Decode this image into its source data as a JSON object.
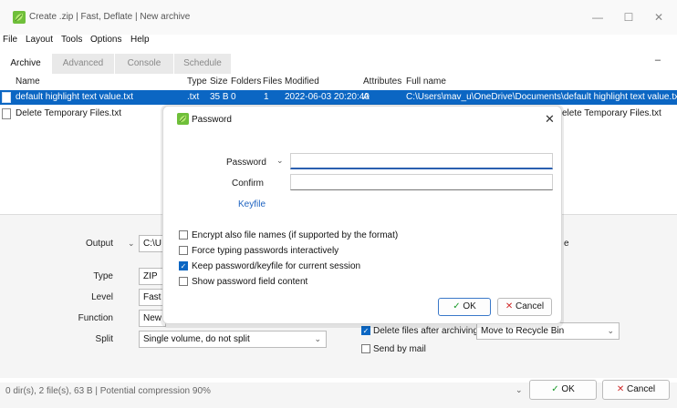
{
  "window": {
    "title": "Create .zip | Fast, Deflate | New archive",
    "minimize": "—",
    "maximize": "☐",
    "close": "✕"
  },
  "menu": [
    "File",
    "Layout",
    "Tools",
    "Options",
    "Help"
  ],
  "tabs": [
    "Archive",
    "Advanced",
    "Console",
    "Schedule"
  ],
  "tab_dash": "–",
  "columns": [
    "Name",
    "Type",
    "Size",
    "Folders",
    "Files",
    "Modified",
    "Attributes",
    "Full name"
  ],
  "rows": [
    {
      "name": "default highlight text value.txt",
      "type": ".txt",
      "size": "35 B",
      "folders": "0",
      "files": "1",
      "modified": "2022-06-03 20:20:40",
      "attributes": "A",
      "fullname": "C:\\Users\\mav_u\\OneDrive\\Documents\\default highlight text value.txt"
    },
    {
      "name": "Delete Temporary Files.txt",
      "fullname_tail": "elete Temporary Files.txt"
    }
  ],
  "lower": {
    "output_label": "Output",
    "output_value": "C:\\U",
    "type_label": "Type",
    "type_value": "ZIP",
    "level_label": "Level",
    "level_value": "Fast",
    "function_label": "Function",
    "function_value": "New",
    "split_label": "Split",
    "split_value": "Single volume, do not split",
    "right_e": "e",
    "delete_after": "Delete files after archiving",
    "delete_after_checked": true,
    "delete_mode": "Move to Recycle Bin",
    "send_mail": "Send by mail",
    "send_mail_checked": false
  },
  "status": {
    "text": "0 dir(s), 2 file(s), 63 B | Potential compression 90%",
    "ok": "OK",
    "cancel": "Cancel"
  },
  "dialog": {
    "title": "Password",
    "close": "✕",
    "password_label": "Password",
    "confirm_label": "Confirm",
    "keyfile": "Keyfile",
    "checks": [
      {
        "label": "Encrypt also file names (if supported by the format)",
        "checked": false
      },
      {
        "label": "Force typing passwords interactively",
        "checked": false
      },
      {
        "label": "Keep password/keyfile for current session",
        "checked": true
      },
      {
        "label": "Show password field content",
        "checked": false
      }
    ],
    "ok": "OK",
    "cancel": "Cancel"
  },
  "colors": {
    "accent": "#0b66c3",
    "ok_green": "#1a9a2a",
    "cancel_red": "#d02a2a"
  }
}
